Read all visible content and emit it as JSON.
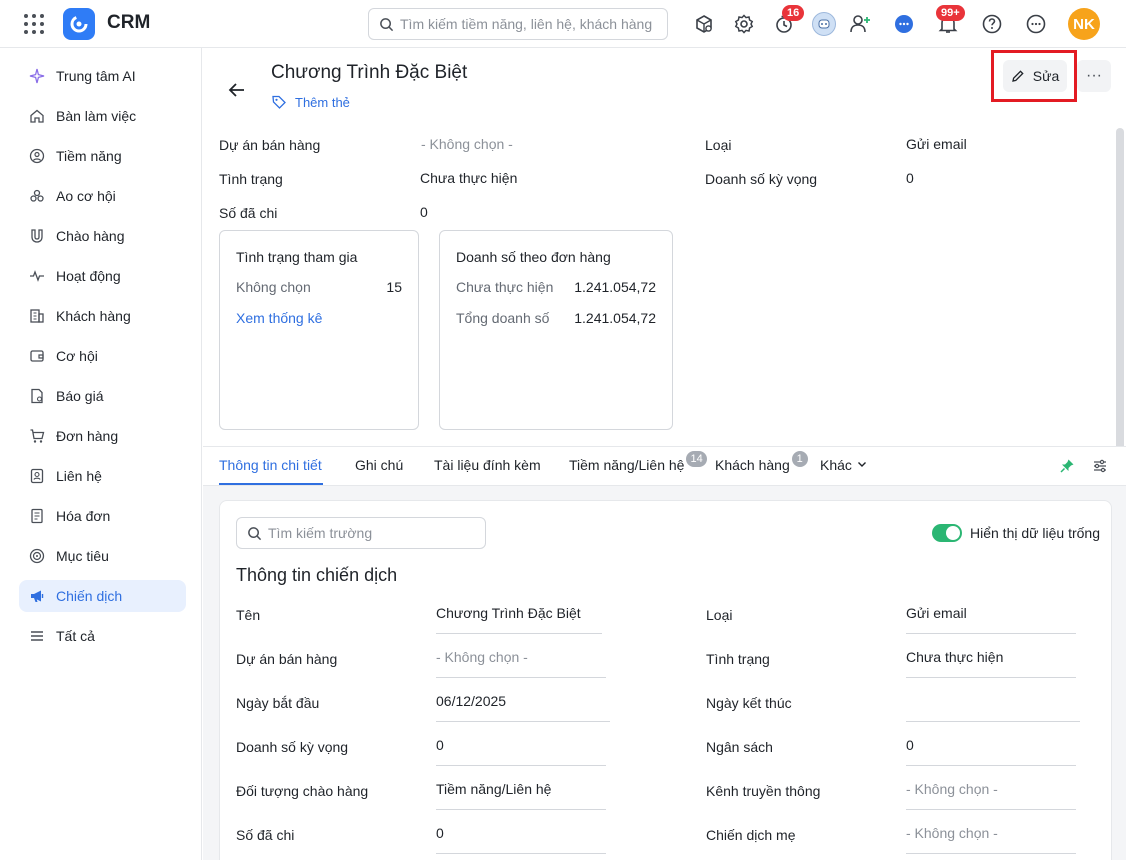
{
  "app": {
    "name": "CRM"
  },
  "search": {
    "placeholder": "Tìm kiếm tiềm năng, liên hệ, khách hàng"
  },
  "top_icons": [
    {
      "name": "box-search-icon"
    },
    {
      "name": "gear-icon"
    },
    {
      "name": "timer-icon",
      "badge": "16"
    },
    {
      "name": "bot-avatar"
    },
    {
      "name": "add-user-icon"
    },
    {
      "name": "chat-icon"
    },
    {
      "name": "bell-icon",
      "badge": "99+"
    },
    {
      "name": "help-icon"
    },
    {
      "name": "more-icon"
    }
  ],
  "user": {
    "initials": "NK",
    "color": "#f7a31b"
  },
  "sidebar": {
    "items": [
      {
        "label": "Trung tâm AI",
        "icon": "sparkle-icon"
      },
      {
        "label": "Bàn làm việc",
        "icon": "home-icon"
      },
      {
        "label": "Tiềm năng",
        "icon": "lead-icon"
      },
      {
        "label": "Ao cơ hội",
        "icon": "users-icon"
      },
      {
        "label": "Chào hàng",
        "icon": "magnet-icon"
      },
      {
        "label": "Hoạt động",
        "icon": "activity-icon"
      },
      {
        "label": "Khách hàng",
        "icon": "building-icon"
      },
      {
        "label": "Cơ hội",
        "icon": "wallet-icon"
      },
      {
        "label": "Báo giá",
        "icon": "quote-icon"
      },
      {
        "label": "Đơn hàng",
        "icon": "cart-icon"
      },
      {
        "label": "Liên hệ",
        "icon": "contact-icon"
      },
      {
        "label": "Hóa đơn",
        "icon": "invoice-icon"
      },
      {
        "label": "Mục tiêu",
        "icon": "target-icon"
      },
      {
        "label": "Chiến dịch",
        "icon": "megaphone-icon",
        "active": true
      },
      {
        "label": "Tất cả",
        "icon": "menu-icon"
      }
    ]
  },
  "record": {
    "title": "Chương Trình Đặc Biệt",
    "add_tag": "Thêm thẻ",
    "edit_label": "Sửa",
    "more_label": "···"
  },
  "overview": {
    "sales_project_label": "Dự án bán hàng",
    "sales_project_value": "- Không chọn -",
    "type_label": "Loại",
    "type_value": "Gửi email",
    "status_label": "Tình trạng",
    "status_value": "Chưa thực hiện",
    "expected_revenue_label": "Doanh số kỳ vọng",
    "expected_revenue_value": "0",
    "spent_label": "Số đã chi",
    "spent_value": "0"
  },
  "participation_card": {
    "title": "Tình trạng tham gia",
    "row_label": "Không chọn",
    "row_value": "15",
    "link": "Xem thống kê"
  },
  "revenue_card": {
    "title": "Doanh số theo đơn hàng",
    "rows": [
      {
        "label": "Chưa thực hiện",
        "value": "1.241.054,72"
      },
      {
        "label": "Tổng doanh số",
        "value": "1.241.054,72"
      }
    ]
  },
  "tabs": [
    {
      "label": "Thông tin chi tiết",
      "active": true
    },
    {
      "label": "Ghi chú"
    },
    {
      "label": "Tài liệu đính kèm"
    },
    {
      "label": "Tiềm năng/Liên hệ",
      "count": "14"
    },
    {
      "label": "Khách hàng",
      "count": "1"
    },
    {
      "label": "Khác"
    }
  ],
  "detail": {
    "field_search_placeholder": "Tìm kiếm trường",
    "toggle_label": "Hiển thị dữ liệu trống",
    "toggle_on": true,
    "section_title": "Thông tin chiến dịch",
    "left_fields": [
      {
        "label": "Tên",
        "value": "Chương Trình Đặc Biệt"
      },
      {
        "label": "Dự án bán hàng",
        "value": "- Không chọn -",
        "muted": true
      },
      {
        "label": "Ngày bắt đầu",
        "value": "06/12/2025"
      },
      {
        "label": "Doanh số kỳ vọng",
        "value": "0"
      },
      {
        "label": "Đối tượng chào hàng",
        "value": "Tiềm năng/Liên hệ"
      },
      {
        "label": "Số đã chi",
        "value": "0"
      }
    ],
    "right_fields": [
      {
        "label": "Loại",
        "value": "Gửi email"
      },
      {
        "label": "Tình trạng",
        "value": "Chưa thực hiện"
      },
      {
        "label": "Ngày kết thúc",
        "value": ""
      },
      {
        "label": "Ngân sách",
        "value": "0"
      },
      {
        "label": "Kênh truyền thông",
        "value": "- Không chọn -",
        "muted": true
      },
      {
        "label": "Chiến dịch mẹ",
        "value": "- Không chọn -",
        "muted": true
      }
    ]
  }
}
